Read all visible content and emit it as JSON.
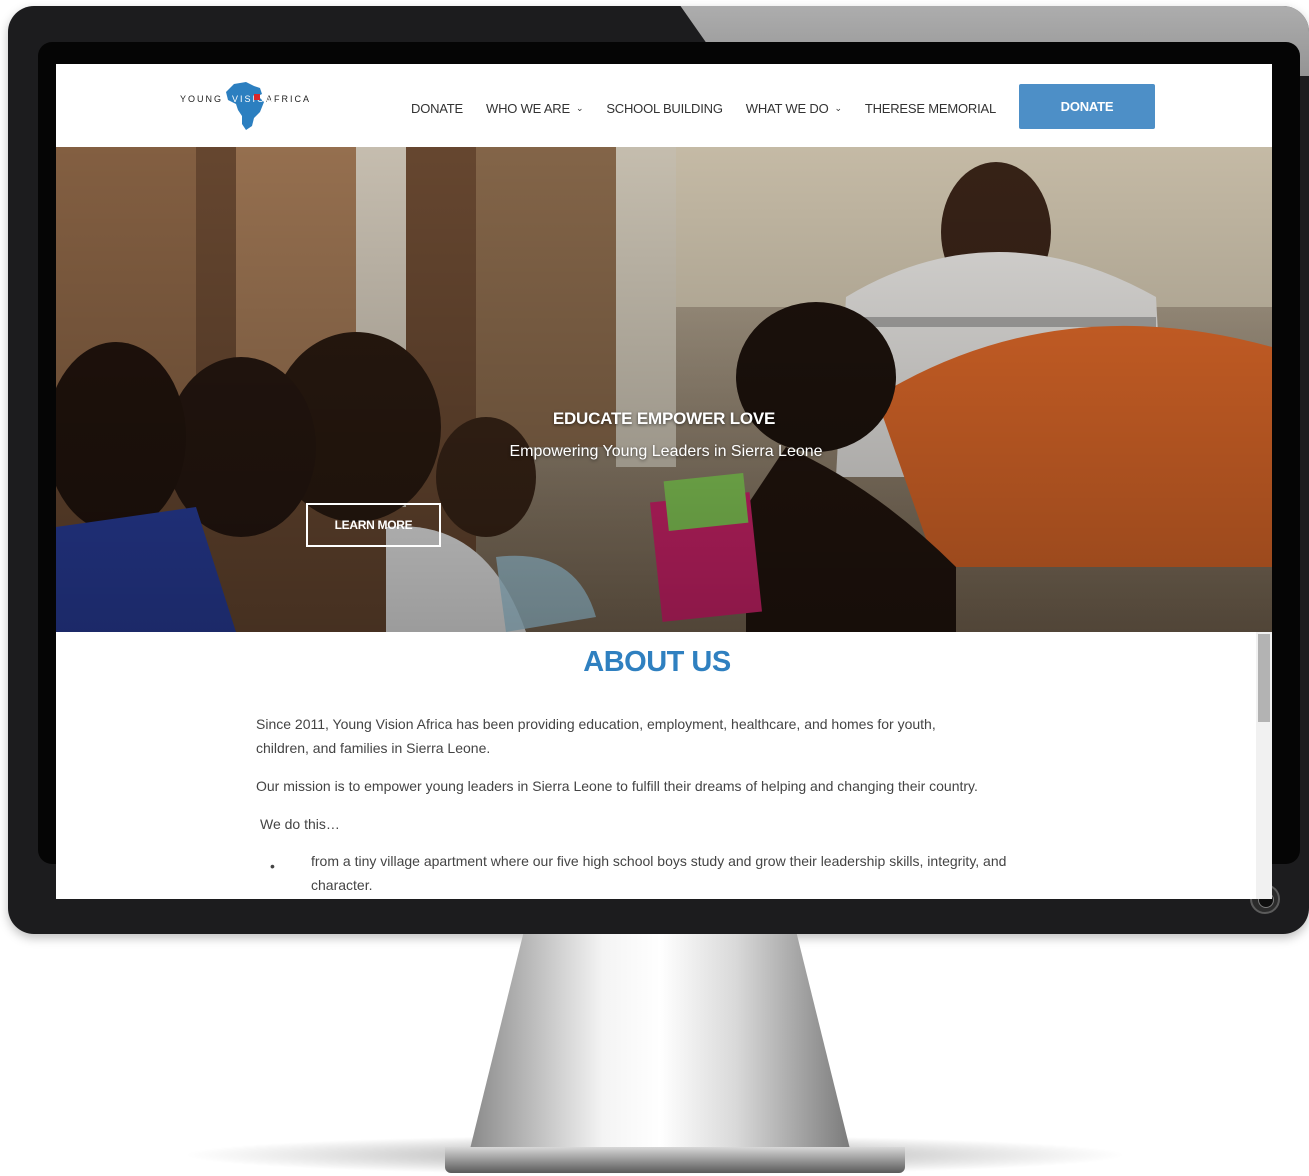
{
  "site": {
    "logo": {
      "word_young": "YOUNG",
      "word_vision": "VISION",
      "word_africa": "AFRICA"
    },
    "nav": {
      "items": [
        {
          "label": "DONATE",
          "dropdown": false
        },
        {
          "label": "WHO WE ARE",
          "dropdown": true
        },
        {
          "label": "SCHOOL BUILDING",
          "dropdown": false
        },
        {
          "label": "WHAT WE DO",
          "dropdown": true
        },
        {
          "label": "THERESE MEMORIAL",
          "dropdown": false
        }
      ],
      "donate_button": "DONATE",
      "chevron": "⌄"
    },
    "hero": {
      "title": "EDUCATE EMPOWER LOVE",
      "subtitle": "Empowering Young Leaders in Sierra Leone",
      "cta": "LEARN MORE"
    },
    "about": {
      "title": "ABOUT US",
      "p1": "Since 2011, Young Vision Africa has been providing education, employment, healthcare, and homes for youth, children, and families in Sierra Leone.",
      "p2": "Our mission is to empower young leaders in Sierra Leone to fulfill their dreams of helping and changing their country.",
      "p3": "We do this…",
      "list": [
        "from a tiny village apartment where our five high school boys study and grow their leadership skills, integrity, and character."
      ],
      "bullet_symbol": "•"
    }
  },
  "colors": {
    "accent": "#4d8fc7",
    "heading": "#2f80c0",
    "logo_red": "#d9262b",
    "text": "#444444"
  },
  "icons": {
    "logo_map": "africa-map-icon",
    "chevron": "chevron-down-icon",
    "power": "power-button-icon"
  }
}
